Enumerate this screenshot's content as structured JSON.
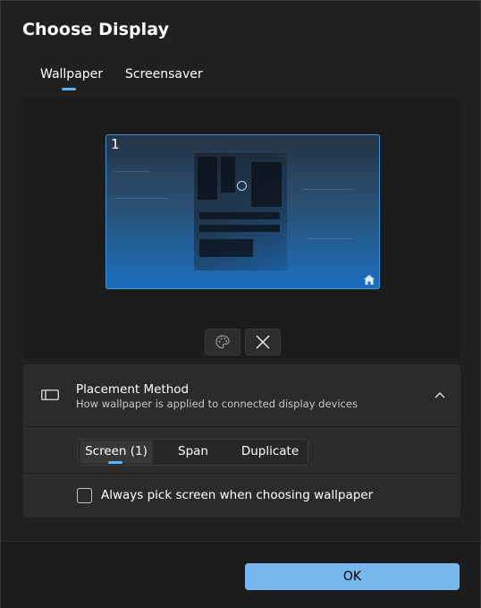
{
  "dialog": {
    "title": "Choose Display"
  },
  "tabs": [
    {
      "label": "Wallpaper",
      "selected": true
    },
    {
      "label": "Screensaver",
      "selected": false
    }
  ],
  "preview": {
    "monitor_number": "1",
    "icons": [
      "home-icon",
      "palette-icon",
      "close-icon"
    ]
  },
  "placement": {
    "title": "Placement Method",
    "subtitle": "How wallpaper is applied to connected display devices",
    "options": [
      {
        "label": "Screen (1)",
        "selected": true
      },
      {
        "label": "Span",
        "selected": false
      },
      {
        "label": "Duplicate",
        "selected": false
      }
    ],
    "checkbox": {
      "label": "Always pick screen when choosing wallpaper",
      "checked": false
    }
  },
  "footer": {
    "ok_label": "OK"
  },
  "colors": {
    "accent": "#60b4f0",
    "ok_button": "#79b8ef",
    "background": "#202020",
    "panel": "#2b2b2b"
  }
}
